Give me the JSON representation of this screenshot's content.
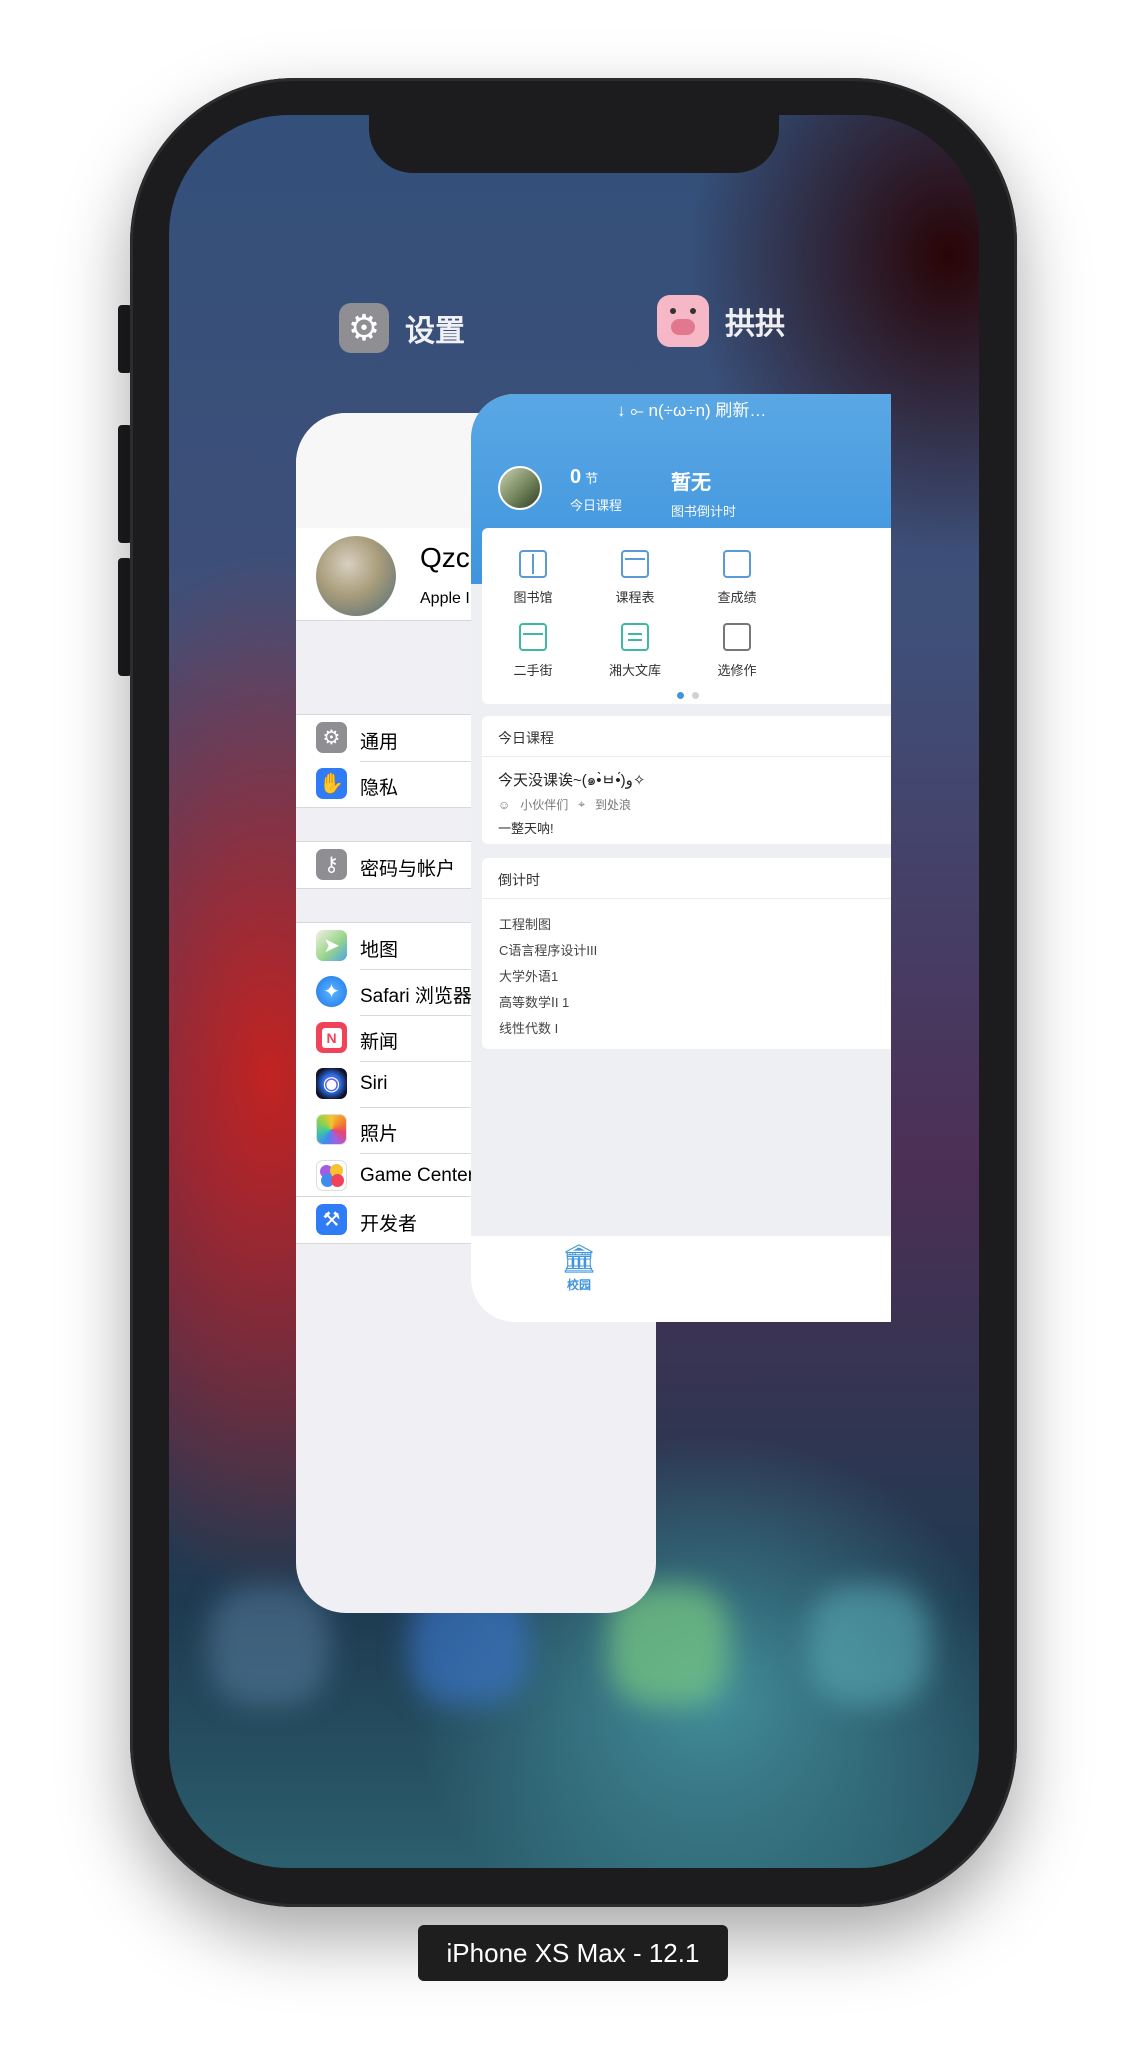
{
  "switcher": {
    "settings_app_name": "设置",
    "gonggong_app_name": "拱拱"
  },
  "settings": {
    "title": "设置",
    "profile": {
      "name": "Qzc Jerry",
      "subtitle": "Apple ID、iCloud、iTunes"
    },
    "group1": [
      {
        "label": "通用",
        "icon": "gear-icon",
        "color": "#8e8e93"
      },
      {
        "label": "隐私",
        "icon": "hand-icon",
        "color": "#2f7cf6"
      }
    ],
    "group2": [
      {
        "label": "密码与帐户",
        "icon": "key-icon",
        "color": "#8e8e93"
      }
    ],
    "group3": [
      {
        "label": "地图",
        "icon": "maps-icon",
        "color": "#6fcf6a"
      },
      {
        "label": "Safari 浏览器",
        "icon": "compass-icon",
        "color": "#2f8ff5"
      },
      {
        "label": "新闻",
        "icon": "news-icon",
        "color": "#f0435a"
      },
      {
        "label": "Siri",
        "icon": "siri-icon",
        "color": "#1f1f3a"
      },
      {
        "label": "照片",
        "icon": "photos-icon",
        "color": "#ffffff"
      },
      {
        "label": "Game Center",
        "icon": "game-center-icon",
        "color": "#ffffff"
      }
    ],
    "group4": [
      {
        "label": "开发者",
        "icon": "hammer-icon",
        "color": "#2f7cf6"
      }
    ]
  },
  "gonggong": {
    "refresh_hint": "↓ ⟜ n(÷ω÷n) 刷新…",
    "stats": [
      {
        "value": "0",
        "unit": "节",
        "label": "今日课程"
      },
      {
        "value": "暂无",
        "unit": "",
        "label": "图书倒计时"
      }
    ],
    "grid": [
      {
        "label": "图书馆",
        "icon": "book-icon"
      },
      {
        "label": "课程表",
        "icon": "calendar-icon"
      },
      {
        "label": "查成绩",
        "icon": "grade-icon"
      },
      {
        "label": "二手街",
        "icon": "store-icon"
      },
      {
        "label": "湘大文库",
        "icon": "document-icon"
      },
      {
        "label": "选修作",
        "icon": "checklist-icon"
      }
    ],
    "today": {
      "header": "今日课程",
      "title": "今天没课诶~(๑•̀ㅂ•́)و✧",
      "people": "小伙伴们",
      "place": "到处浪",
      "note": "一整天呐!"
    },
    "countdown": {
      "header": "倒计时",
      "items": [
        "工程制图",
        "C语言程序设计III",
        "大学外语1",
        "高等数学ⅠI 1",
        "线性代数 I"
      ]
    },
    "tab_campus": "校园"
  },
  "caption": "iPhone XS Max - 12.1"
}
